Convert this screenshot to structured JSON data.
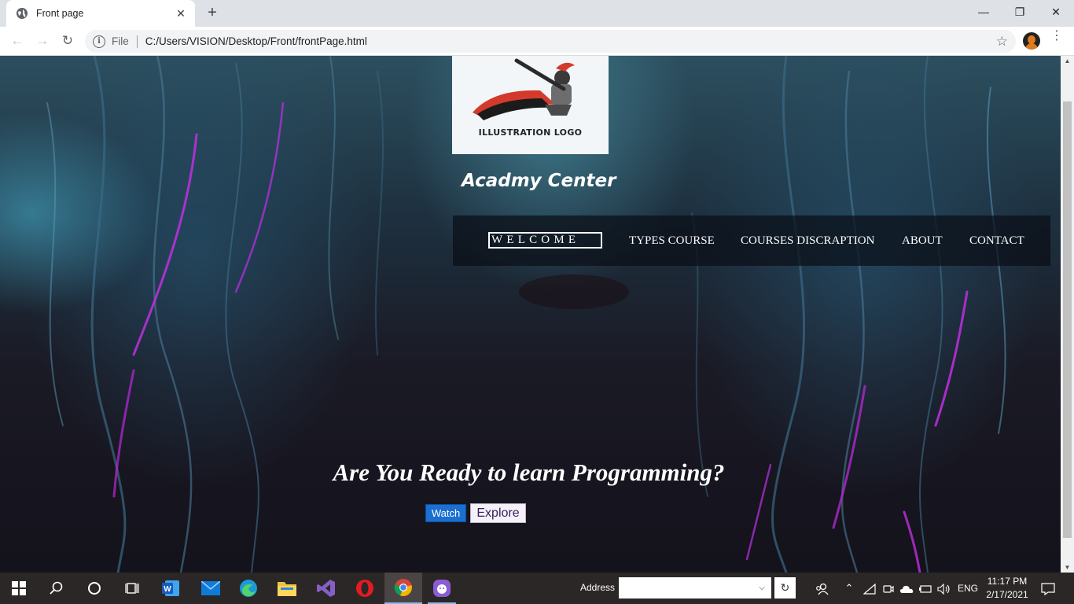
{
  "browser": {
    "tab_title": "Front page",
    "tab_close": "✕",
    "new_tab": "+",
    "window": {
      "minimize": "—",
      "restore": "❐",
      "close": "✕"
    },
    "nav": {
      "back": "←",
      "forward": "→",
      "reload": "↻"
    },
    "address": {
      "info": "i",
      "scheme_label": "File",
      "url": "C:/Users/VISION/Desktop/Front/frontPage.html",
      "bookmark": "☆"
    },
    "menu": "⋮"
  },
  "page": {
    "logo_text": "ILLUSTRATION LOGO",
    "brand": "Acadmy Center",
    "nav": {
      "welcome": "WELCOME",
      "types_course": "TYPES COURSE",
      "courses_description": "COURSES DISCRAPTION",
      "about": "ABOUT",
      "contact": "CONTACT"
    },
    "headline": "Are You Ready to learn Programming?",
    "buttons": {
      "watch": "Watch",
      "explore": "Explore"
    }
  },
  "taskbar": {
    "address_label": "Address",
    "address_value": "",
    "tray": {
      "language": "ENG"
    },
    "clock": {
      "time": "11:17 PM",
      "date": "2/17/2021"
    },
    "apps": [
      "start",
      "search",
      "cortana",
      "task-view",
      "word",
      "mail",
      "edge",
      "file-explorer",
      "visual-studio",
      "opera",
      "chrome",
      "purple-app"
    ]
  },
  "colors": {
    "tab_strip": "#dee1e6",
    "nav_bar_bg": "rgba(10,14,22,0.72)",
    "watch_button": "#1a6fd0",
    "explore_button": "#f4f2f8",
    "taskbar": "#2b2727"
  }
}
